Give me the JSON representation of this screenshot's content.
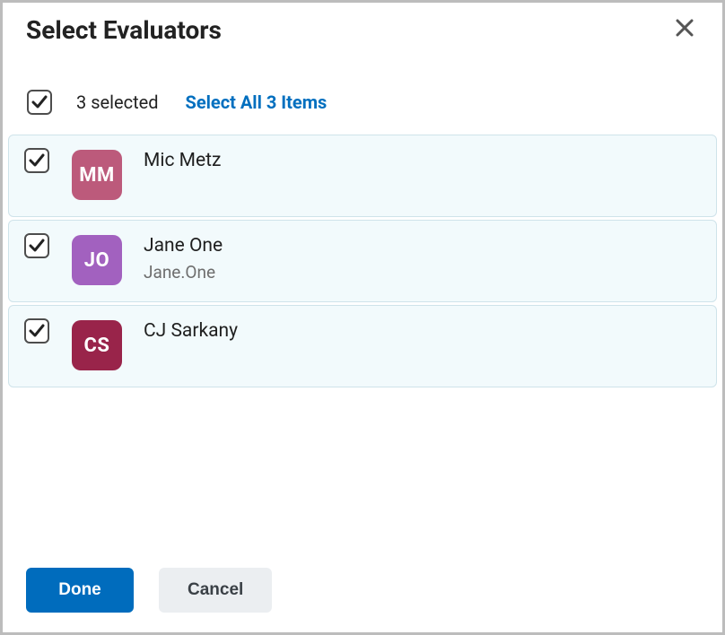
{
  "dialog": {
    "title": "Select Evaluators"
  },
  "selectBar": {
    "selected_count_label": "3 selected",
    "select_all_label": "Select All 3 Items"
  },
  "evaluators": [
    {
      "initials": "MM",
      "name": "Mic Metz",
      "sub": "",
      "avatar_color": "#bc5a7b"
    },
    {
      "initials": "JO",
      "name": "Jane One",
      "sub": "Jane.One",
      "avatar_color": "#a261bf"
    },
    {
      "initials": "CS",
      "name": "CJ Sarkany",
      "sub": "",
      "avatar_color": "#99244a"
    }
  ],
  "footer": {
    "done_label": "Done",
    "cancel_label": "Cancel"
  }
}
